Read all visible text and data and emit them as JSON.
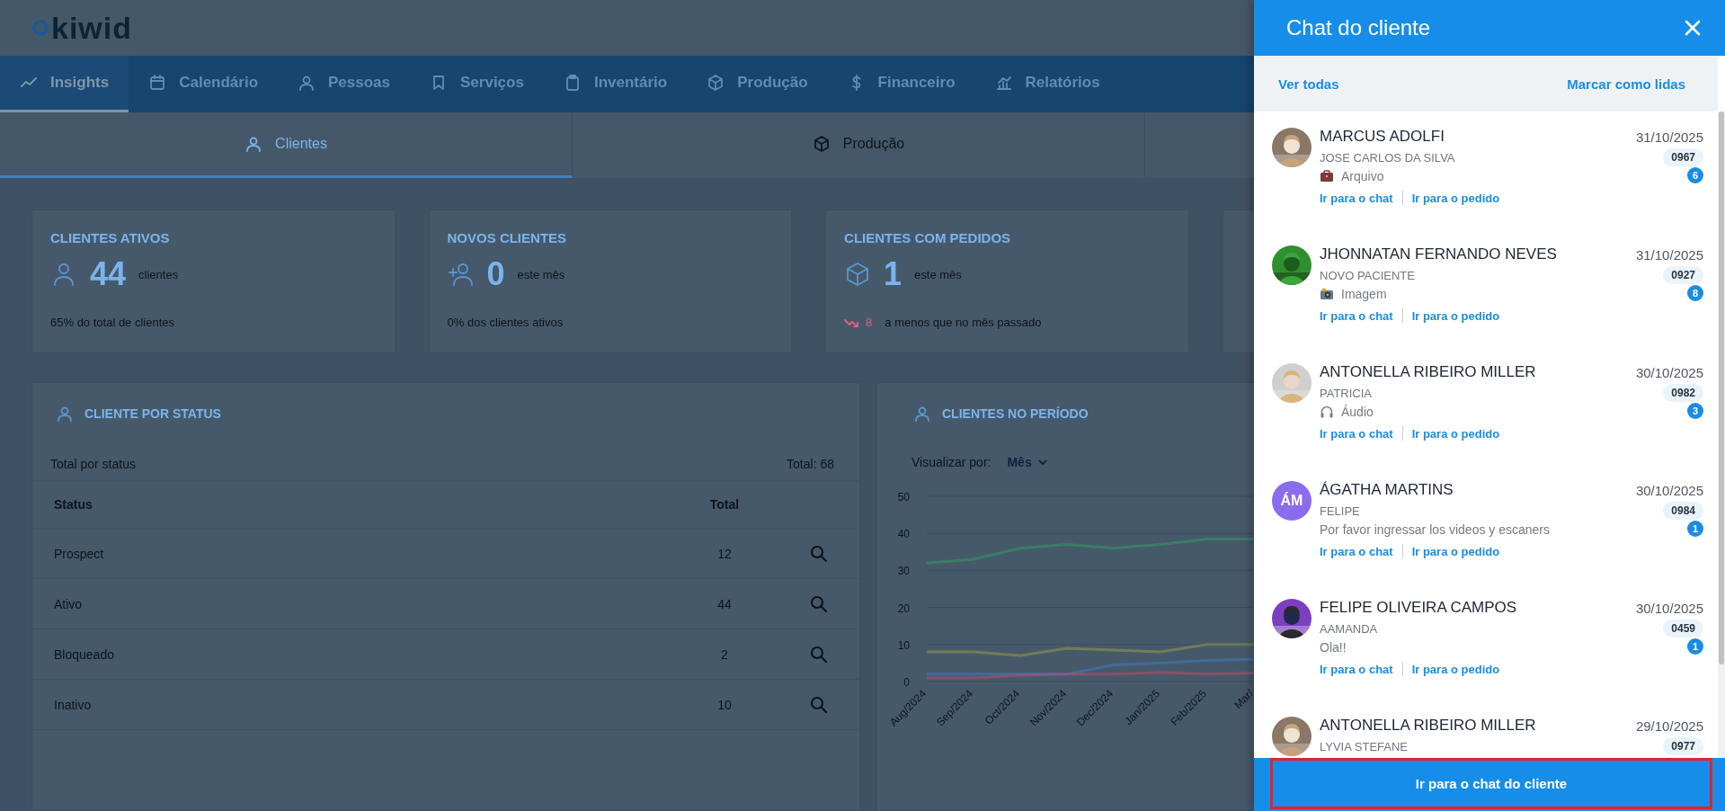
{
  "logo": "kiwid",
  "nav": [
    {
      "label": "Insights",
      "selected": true
    },
    {
      "label": "Calendário",
      "selected": false
    },
    {
      "label": "Pessoas",
      "selected": false
    },
    {
      "label": "Serviços",
      "selected": false
    },
    {
      "label": "Inventário",
      "selected": false
    },
    {
      "label": "Produção",
      "selected": false
    },
    {
      "label": "Financeiro",
      "selected": false
    },
    {
      "label": "Relatórios",
      "selected": false
    }
  ],
  "subtabs": [
    {
      "label": "Clientes",
      "selected": true
    },
    {
      "label": "Produção",
      "selected": false
    }
  ],
  "stats": [
    {
      "title": "CLIENTES ATIVOS",
      "value": "44",
      "unit": "clientes",
      "footnote": "65% do total de clientes"
    },
    {
      "title": "NOVOS CLIENTES",
      "value": "0",
      "unit": "este mês",
      "footnote": "0% dos clientes ativos"
    },
    {
      "title": "CLIENTES COM PEDIDOS",
      "value": "1",
      "unit": "este mês",
      "change": "8",
      "footnote": "a menos que no mês passado"
    }
  ],
  "status_table": {
    "title": "CLIENTE POR STATUS",
    "summary_label": "Total por status",
    "summary_total": "Total: 68",
    "columns": [
      "Status",
      "Total"
    ],
    "rows": [
      {
        "status": "Prospect",
        "total": "12"
      },
      {
        "status": "Ativo",
        "total": "44"
      },
      {
        "status": "Bloqueado",
        "total": "2"
      },
      {
        "status": "Inativo",
        "total": "10"
      }
    ]
  },
  "period_chart": {
    "title": "CLIENTES NO PERÍODO",
    "view_label": "Visualizar por:",
    "view_value": "Mês",
    "chart_data": {
      "type": "line",
      "grid": true,
      "categories": [
        "Aug/2024",
        "Sep/2024",
        "Oct/2024",
        "Nov/2024",
        "Dec/2024",
        "Jan/2025",
        "Feb/2025",
        "Mar/"
      ],
      "yticks": [
        0,
        10,
        20,
        30,
        40,
        50
      ],
      "ylim": [
        0,
        50
      ],
      "series": [
        {
          "color": "#2fa860",
          "values": [
            32,
            33,
            36,
            37,
            36,
            37,
            38.5,
            38.5
          ]
        },
        {
          "color": "#a8a63a",
          "values": [
            8,
            8,
            7,
            9,
            8.5,
            8,
            10,
            10
          ]
        },
        {
          "color": "#3b82d6",
          "values": [
            2,
            2,
            2,
            2,
            4.5,
            5,
            5.7,
            6
          ]
        },
        {
          "color": "#d84a6a",
          "values": [
            1,
            1,
            1.7,
            2,
            2,
            2.5,
            2,
            2.3
          ]
        }
      ]
    }
  },
  "chat_panel": {
    "title": "Chat do cliente",
    "actions": [
      "Ver todas",
      "Marcar como lidas"
    ],
    "items": [
      {
        "avatar": {
          "kind": "picture"
        },
        "name": "MARCUS ADOLFI",
        "date": "31/10/2025",
        "subtitle": "JOSE CARLOS DA SILVA",
        "order": "0967",
        "unread": "6",
        "kind": "file",
        "message": "Arquivo",
        "links": [
          "Ir para o chat",
          "Ir para o pedido"
        ]
      },
      {
        "avatar": {
          "kind": "picture"
        },
        "name": "JHONNATAN FERNANDO NEVES",
        "date": "31/10/2025",
        "subtitle": "NOVO PACIENTE",
        "order": "0927",
        "unread": "8",
        "message": "Imagem",
        "links": [
          "Ir para o chat",
          "Ir para o pedido"
        ]
      },
      {
        "avatar": {
          "kind": "picture"
        },
        "name": "ANTONELLA RIBEIRO MILLER",
        "date": "30/10/2025",
        "subtitle": "PATRICIA",
        "order": "0982",
        "unread": "3",
        "kind": "audio",
        "message": "Áudio",
        "links": [
          "Ir para o chat",
          "Ir para o pedido"
        ]
      },
      {
        "avatar": {
          "kind": "initials",
          "initials": "ÁM",
          "color": "#8b6cef"
        },
        "name": "ÁGATHA MARTINS",
        "date": "30/10/2025",
        "subtitle": "FELIPE",
        "order": "0984",
        "unread": "1",
        "kind": "text",
        "message": "Por favor ingressar los videos y escaners",
        "links": [
          "Ir para o chat",
          "Ir para o pedido"
        ]
      },
      {
        "avatar": {
          "kind": "picture"
        },
        "name": "FELIPE OLIVEIRA CAMPOS",
        "date": "30/10/2025",
        "subtitle": "AAMANDA",
        "order": "0459",
        "unread": "1",
        "kind": "text",
        "message": "Ola!!",
        "links": [
          "Ir para o chat",
          "Ir para o pedido"
        ]
      },
      {
        "avatar": {
          "kind": "picture"
        },
        "name": "ANTONELLA RIBEIRO MILLER",
        "date": "29/10/2025",
        "subtitle": "LYVIA STEFANE",
        "order": "0977"
      }
    ],
    "footer_button": {
      "label": "Ir para o chat do cliente",
      "highlighted": true
    }
  }
}
